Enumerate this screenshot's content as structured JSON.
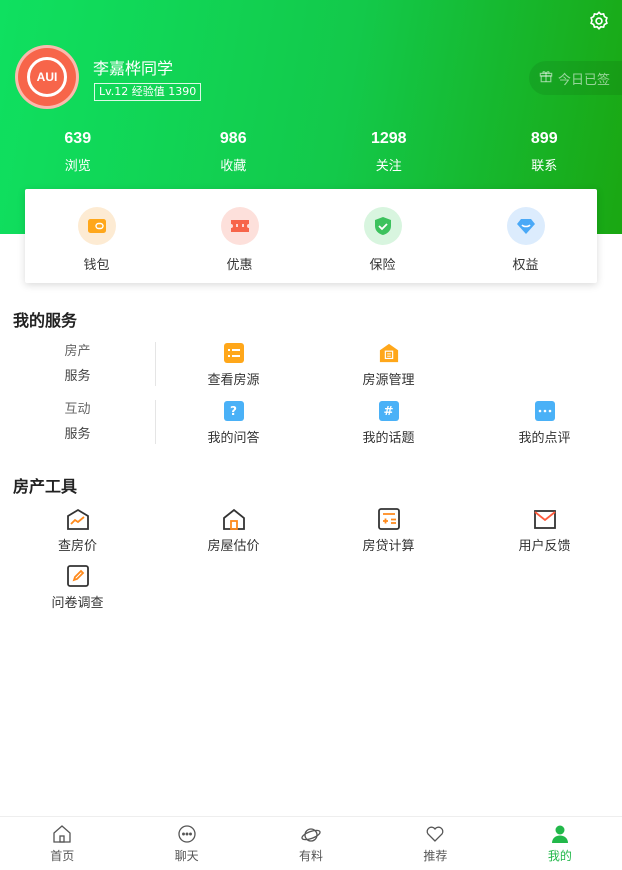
{
  "colors": {
    "brand_green": "#13c94a",
    "accent_orange": "#ff9f1c",
    "active_tab": "#22b84a"
  },
  "profile": {
    "avatar_text": "AUI",
    "name": "李嘉桦同学",
    "level_text": "Lv.12 经验值 1390",
    "checkin_label": "今日已签",
    "checkin_icon": "gift-icon",
    "settings_icon": "gear-icon"
  },
  "stats": [
    {
      "value": "639",
      "label": "浏览"
    },
    {
      "value": "986",
      "label": "收藏"
    },
    {
      "value": "1298",
      "label": "关注"
    },
    {
      "value": "899",
      "label": "联系"
    }
  ],
  "quick_actions": [
    {
      "label": "钱包",
      "icon": "wallet-icon"
    },
    {
      "label": "优惠",
      "icon": "coupon-icon"
    },
    {
      "label": "保险",
      "icon": "shield-check-icon"
    },
    {
      "label": "权益",
      "icon": "diamond-icon"
    }
  ],
  "services": {
    "title": "我的服务",
    "rows": [
      {
        "category": [
          "房产",
          "服务"
        ],
        "items": [
          {
            "label": "查看房源",
            "icon": "list-icon"
          },
          {
            "label": "房源管理",
            "icon": "house-doc-icon"
          }
        ]
      },
      {
        "category": [
          "互动",
          "服务"
        ],
        "items": [
          {
            "label": "我的问答",
            "icon": "question-icon"
          },
          {
            "label": "我的话题",
            "icon": "hashtag-icon"
          },
          {
            "label": "我的点评",
            "icon": "comment-icon"
          }
        ]
      }
    ]
  },
  "tools": {
    "title": "房产工具",
    "items": [
      {
        "label": "查房价",
        "icon": "trend-chart-icon"
      },
      {
        "label": "房屋估价",
        "icon": "house-icon"
      },
      {
        "label": "房贷计算",
        "icon": "calculator-icon"
      },
      {
        "label": "用户反馈",
        "icon": "mail-icon"
      },
      {
        "label": "问卷调查",
        "icon": "edit-icon"
      }
    ]
  },
  "tabbar": [
    {
      "label": "首页",
      "icon": "home-icon"
    },
    {
      "label": "聊天",
      "icon": "chat-icon"
    },
    {
      "label": "有料",
      "icon": "planet-icon"
    },
    {
      "label": "推荐",
      "icon": "heart-icon"
    },
    {
      "label": "我的",
      "icon": "user-icon",
      "active": true
    }
  ]
}
